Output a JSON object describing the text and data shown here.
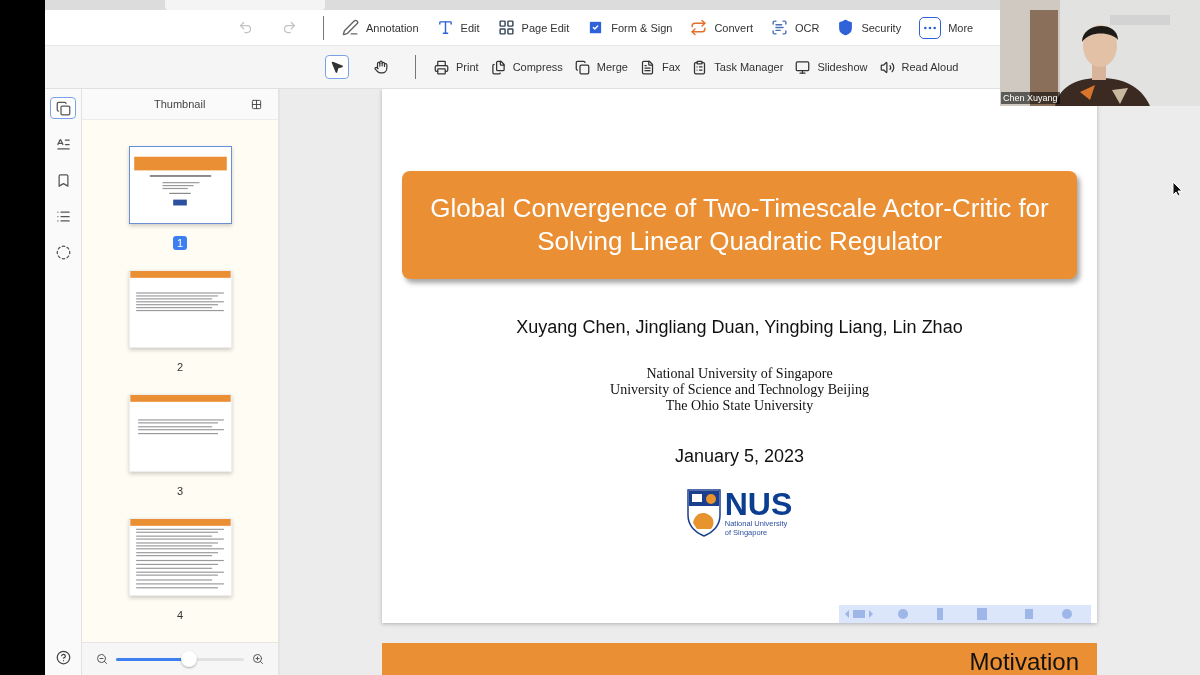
{
  "history": [
    {
      "kind": "undo",
      "disabled": true
    },
    {
      "kind": "redo",
      "disabled": true
    }
  ],
  "main_tools": [
    {
      "kind": "annotation",
      "label": "Annotation"
    },
    {
      "kind": "edit",
      "label": "Edit"
    },
    {
      "kind": "page_edit",
      "label": "Page Edit"
    },
    {
      "kind": "form_sign",
      "label": "Form & Sign"
    },
    {
      "kind": "convert",
      "label": "Convert"
    },
    {
      "kind": "ocr",
      "label": "OCR"
    },
    {
      "kind": "security",
      "label": "Security"
    },
    {
      "kind": "more",
      "label": "More"
    }
  ],
  "modes": [
    {
      "kind": "select",
      "selected": true
    },
    {
      "kind": "hand",
      "selected": false
    }
  ],
  "tools": [
    {
      "kind": "print",
      "label": "Print"
    },
    {
      "kind": "compress",
      "label": "Compress"
    },
    {
      "kind": "merge",
      "label": "Merge"
    },
    {
      "kind": "fax",
      "label": "Fax"
    },
    {
      "kind": "task_manager",
      "label": "Task Manager"
    },
    {
      "kind": "slideshow",
      "label": "Slideshow"
    },
    {
      "kind": "read_aloud",
      "label": "Read Aloud"
    }
  ],
  "rail": [
    {
      "kind": "thumbnails",
      "selected": true
    },
    {
      "kind": "text",
      "selected": false
    },
    {
      "kind": "bookmark",
      "selected": false
    },
    {
      "kind": "outline",
      "selected": false
    },
    {
      "kind": "ocr",
      "selected": false
    }
  ],
  "thumbnail_panel": {
    "title": "Thumbnail",
    "pages": [
      {
        "number": "1",
        "kind": "title",
        "selected": true
      },
      {
        "number": "2",
        "kind": "text",
        "selected": false
      },
      {
        "number": "3",
        "kind": "bullets",
        "selected": false
      },
      {
        "number": "4",
        "kind": "math",
        "selected": false
      }
    ],
    "zoom": {
      "level": 0.57
    }
  },
  "slide": {
    "title": "Global Convergence of Two-Timescale Actor-Critic for Solving Linear Quadratic Regulator",
    "authors": "Xuyang Chen, Jingliang Duan, Yingbing Liang, Lin Zhao",
    "affiliations": [
      "National University of Singapore",
      "University of Science and Technology Beijing",
      "The Ohio State University"
    ],
    "date": "January 5, 2023",
    "logo": {
      "mark": "NUS",
      "lines": [
        "National University",
        "of Singapore"
      ]
    }
  },
  "next_slide": {
    "title": "Motivation"
  },
  "video": {
    "name": "Chen Xuyang"
  }
}
